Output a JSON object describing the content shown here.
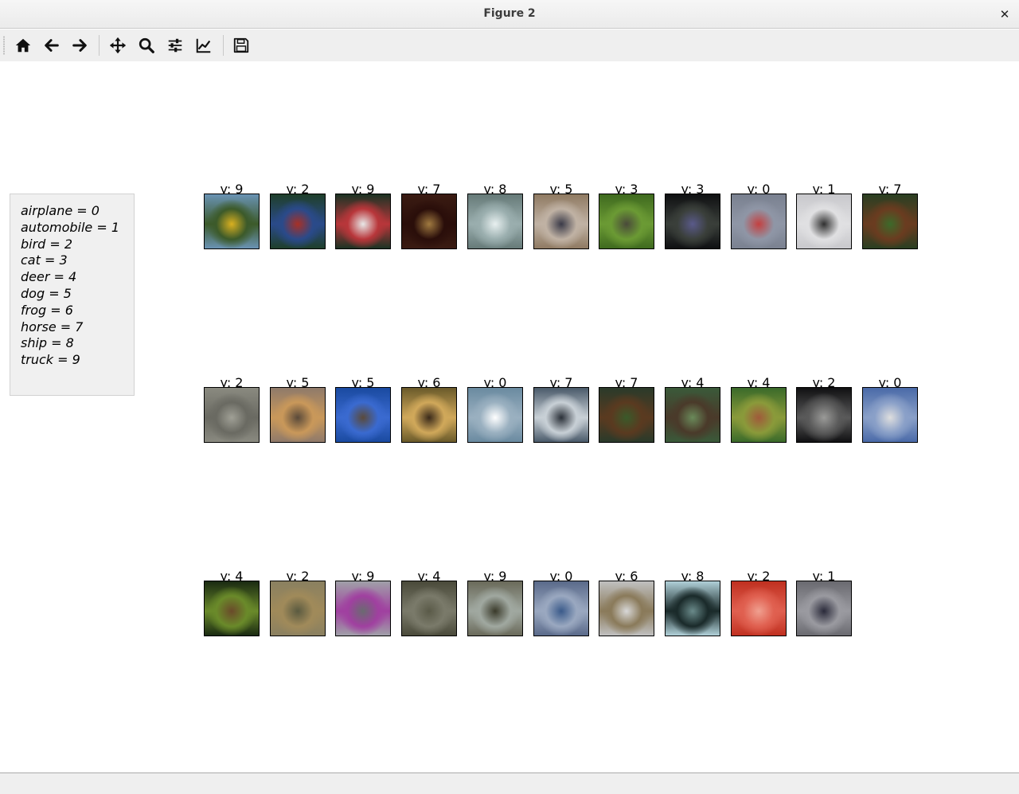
{
  "window": {
    "title": "Figure 2"
  },
  "toolbar": {
    "buttons": [
      {
        "name": "home-button",
        "icon": "home-icon"
      },
      {
        "name": "back-button",
        "icon": "arrow-left-icon"
      },
      {
        "name": "forward-button",
        "icon": "arrow-right-icon"
      },
      {
        "name": "pan-button",
        "icon": "move-icon"
      },
      {
        "name": "zoom-button",
        "icon": "search-icon"
      },
      {
        "name": "configure-subplots-button",
        "icon": "sliders-icon"
      },
      {
        "name": "edit-axes-button",
        "icon": "line-chart-icon"
      },
      {
        "name": "save-button",
        "icon": "floppy-disk-icon"
      }
    ]
  },
  "legend": {
    "lines": [
      "airplane = 0",
      "automobile = 1",
      "bird = 2",
      "cat = 3",
      "deer = 4",
      "dog = 5",
      "frog = 6",
      "horse = 7",
      "ship = 8",
      "truck = 9"
    ]
  },
  "rows": [
    [
      {
        "label": "y: 9",
        "colors": [
          "#6a93b4",
          "#3c5a2a",
          "#d9b020"
        ]
      },
      {
        "label": "y: 2",
        "colors": [
          "#1f3f2a",
          "#2a4a8a",
          "#a83025"
        ]
      },
      {
        "label": "y: 9",
        "colors": [
          "#1c3324",
          "#b8363a",
          "#e8e8e8"
        ]
      },
      {
        "label": "y: 7",
        "colors": [
          "#3a1b12",
          "#2a0e0a",
          "#a07a40"
        ]
      },
      {
        "label": "y: 8",
        "colors": [
          "#667a78",
          "#9aaeae",
          "#e8f0f0"
        ]
      },
      {
        "label": "y: 5",
        "colors": [
          "#8f7a62",
          "#c0b2a4",
          "#3a3a48"
        ]
      },
      {
        "label": "y: 3",
        "colors": [
          "#3f6a1f",
          "#6b9a34",
          "#4a4a3a"
        ]
      },
      {
        "label": "y: 3",
        "colors": [
          "#0f1012",
          "#3a3f3a",
          "#5a5a8a"
        ]
      },
      {
        "label": "y: 0",
        "colors": [
          "#7a8190",
          "#8f96a6",
          "#c44040"
        ]
      },
      {
        "label": "y: 1",
        "colors": [
          "#c8c8cc",
          "#e0e0e2",
          "#303030"
        ]
      },
      {
        "label": "y: 7",
        "colors": [
          "#2a3f22",
          "#6a3c20",
          "#3c6a2a"
        ]
      }
    ],
    [
      {
        "label": "y: 2",
        "colors": [
          "#8a8a80",
          "#6a6a62",
          "#a0a096"
        ]
      },
      {
        "label": "y: 5",
        "colors": [
          "#8f7a6a",
          "#c9985a",
          "#5a4a3a"
        ]
      },
      {
        "label": "y: 5",
        "colors": [
          "#1a4aa0",
          "#3a6ad0",
          "#5a4a3a"
        ]
      },
      {
        "label": "y: 6",
        "colors": [
          "#6a5a2a",
          "#d0a85a",
          "#3a2a1a"
        ]
      },
      {
        "label": "y: 0",
        "colors": [
          "#6a8aa0",
          "#9ab0c0",
          "#ffffff"
        ]
      },
      {
        "label": "y: 7",
        "colors": [
          "#4a5a6a",
          "#c8d0d6",
          "#2a3038"
        ]
      },
      {
        "label": "y: 7",
        "colors": [
          "#2a3a2a",
          "#5a3a20",
          "#3a5a2a"
        ]
      },
      {
        "label": "y: 4",
        "colors": [
          "#3a5a3a",
          "#4a3a2a",
          "#6a8a5a"
        ]
      },
      {
        "label": "y: 4",
        "colors": [
          "#3a6a2a",
          "#8a9a3a",
          "#a05a3a"
        ]
      },
      {
        "label": "y: 2",
        "colors": [
          "#101012",
          "#5a5a5a",
          "#9a9a98"
        ]
      },
      {
        "label": "y: 0",
        "colors": [
          "#4a6aa8",
          "#8aa0c8",
          "#dedede"
        ]
      }
    ],
    [
      {
        "label": "y: 4",
        "colors": [
          "#1a2a12",
          "#6a8a2a",
          "#6a4a2a"
        ]
      },
      {
        "label": "y: 2",
        "colors": [
          "#8a8060",
          "#a08a5a",
          "#5a5a40"
        ]
      },
      {
        "label": "y: 9",
        "colors": [
          "#a0a0a8",
          "#a040a0",
          "#6a6a70"
        ]
      },
      {
        "label": "y: 4",
        "colors": [
          "#4a4a3a",
          "#7a7a6a",
          "#5a5a48"
        ]
      },
      {
        "label": "y: 9",
        "colors": [
          "#6a6a5a",
          "#a0a8a0",
          "#3a3a2a"
        ]
      },
      {
        "label": "y: 0",
        "colors": [
          "#5a6a8a",
          "#9aa8c0",
          "#3a5a8a"
        ]
      },
      {
        "label": "y: 6",
        "colors": [
          "#c0c0c0",
          "#8a7a5a",
          "#d8d8d8"
        ]
      },
      {
        "label": "y: 8",
        "colors": [
          "#b0d0d8",
          "#1a2a2a",
          "#6a8a8a"
        ]
      },
      {
        "label": "y: 2",
        "colors": [
          "#c03020",
          "#e06050",
          "#f0a090"
        ]
      },
      {
        "label": "y: 1",
        "colors": [
          "#6a6a70",
          "#9a9aa0",
          "#2a2a3a"
        ]
      }
    ]
  ]
}
